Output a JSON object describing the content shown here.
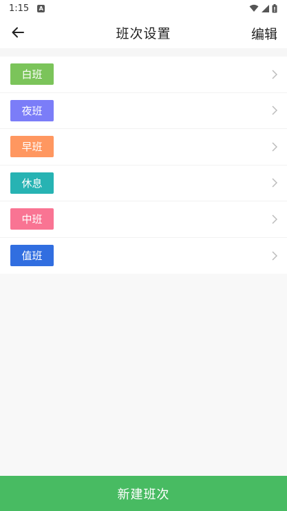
{
  "status_bar": {
    "time": "1:15",
    "icons": [
      "notification-a-icon",
      "wifi-icon",
      "signal-icon",
      "battery-icon"
    ]
  },
  "app_bar": {
    "back_icon": "arrow-left-icon",
    "title": "班次设置",
    "edit_label": "编辑"
  },
  "shifts": [
    {
      "label": "白班",
      "color": "#7bc45a"
    },
    {
      "label": "夜班",
      "color": "#7b7df8"
    },
    {
      "label": "早班",
      "color": "#ff9760"
    },
    {
      "label": "休息",
      "color": "#27b3b3"
    },
    {
      "label": "中班",
      "color": "#f97493"
    },
    {
      "label": "值班",
      "color": "#316ee0"
    }
  ],
  "row_icon": "chevron-right-icon",
  "new_shift_label": "新建班次",
  "colors": {
    "accent": "#48bb62",
    "background": "#f8f8f8"
  }
}
